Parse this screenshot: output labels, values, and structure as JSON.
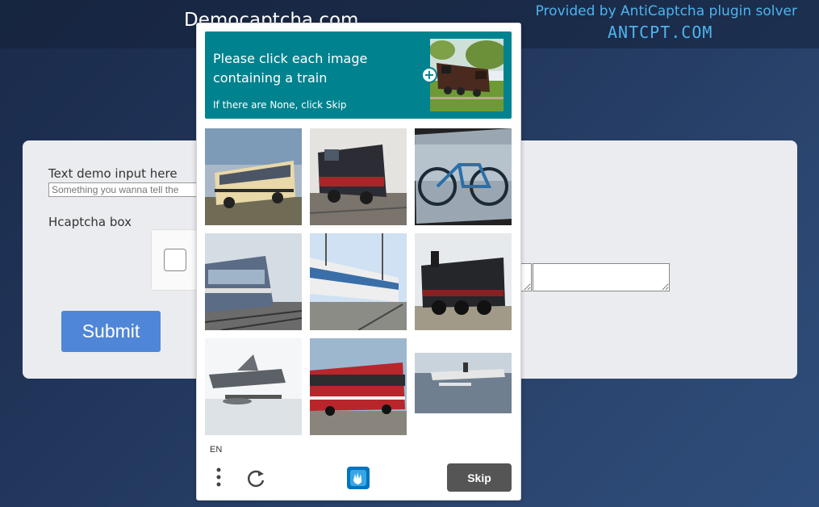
{
  "header": {
    "site_title": "Democaptcha.com",
    "provided_by": "Provided by AntiCaptcha plugin solver",
    "brand": "ANTCPT.COM"
  },
  "form": {
    "text_label": "Text demo input here",
    "text_placeholder": "Something you wanna tell the",
    "hcaptcha_label": "Hcaptcha box",
    "submit_label": "Submit"
  },
  "captcha": {
    "prompt_title": "Please click each image containing a train",
    "prompt_sub": "If there are None, click Skip",
    "example_image": "train",
    "plus_symbol": "+",
    "tiles": [
      {
        "subject": "bus"
      },
      {
        "subject": "train"
      },
      {
        "subject": "bicycle"
      },
      {
        "subject": "train"
      },
      {
        "subject": "train"
      },
      {
        "subject": "train"
      },
      {
        "subject": "seaplane"
      },
      {
        "subject": "train"
      },
      {
        "subject": "seaplane"
      }
    ],
    "language": "EN",
    "skip_label": "Skip",
    "accent_color": "#00838f"
  }
}
